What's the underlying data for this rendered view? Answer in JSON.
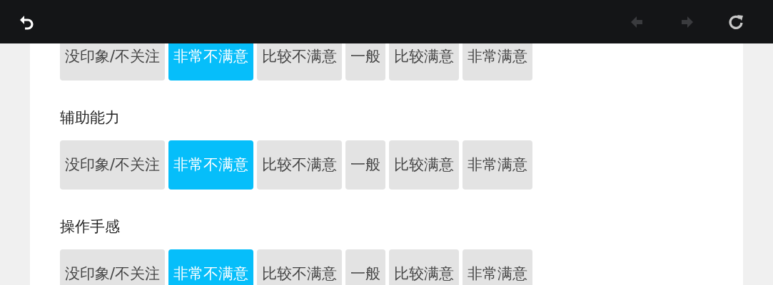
{
  "toolbar": [
    {
      "kind": "back",
      "disabled": false
    },
    {
      "kind": "prev",
      "disabled": true
    },
    {
      "kind": "next",
      "disabled": true
    },
    {
      "kind": "refresh",
      "disabled": false
    }
  ],
  "groups": [
    {
      "options": [
        {
          "label": "没印象/不关注",
          "selected": false
        },
        {
          "label": "非常不满意",
          "selected": true
        },
        {
          "label": "比较不满意",
          "selected": false
        },
        {
          "label": "一般",
          "selected": false
        },
        {
          "label": "比较满意",
          "selected": false
        },
        {
          "label": "非常满意",
          "selected": false
        }
      ]
    },
    {
      "title": "辅助能力",
      "options": [
        {
          "label": "没印象/不关注",
          "selected": false
        },
        {
          "label": "非常不满意",
          "selected": true
        },
        {
          "label": "比较不满意",
          "selected": false
        },
        {
          "label": "一般",
          "selected": false
        },
        {
          "label": "比较满意",
          "selected": false
        },
        {
          "label": "非常满意",
          "selected": false
        }
      ]
    },
    {
      "title": "操作手感",
      "options": [
        {
          "label": "没印象/不关注",
          "selected": false
        },
        {
          "label": "非常不满意",
          "selected": true
        },
        {
          "label": "比较不满意",
          "selected": false
        },
        {
          "label": "一般",
          "selected": false
        },
        {
          "label": "比较满意",
          "selected": false
        },
        {
          "label": "非常满意",
          "selected": false
        }
      ]
    }
  ]
}
